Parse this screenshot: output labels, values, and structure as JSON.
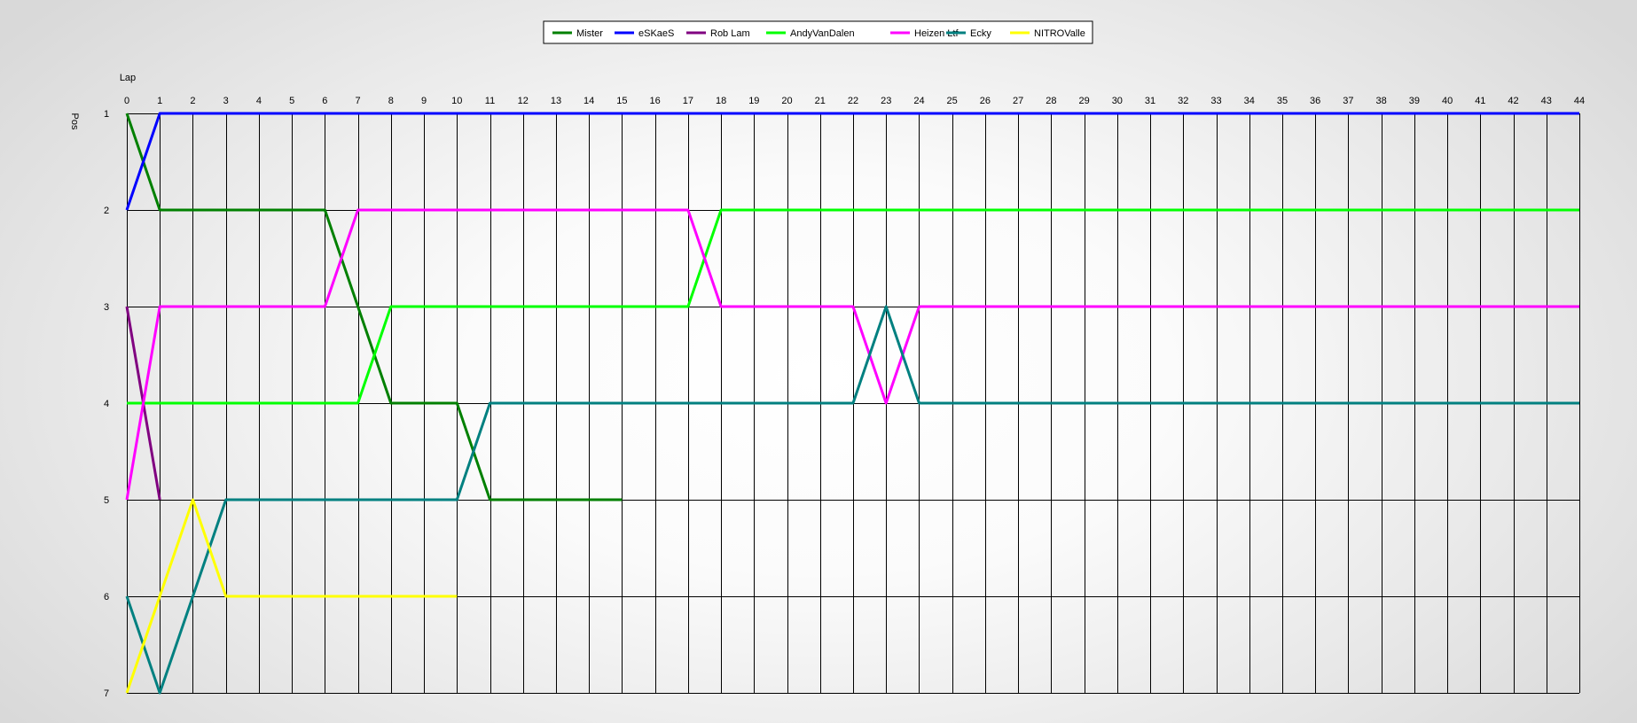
{
  "chart_data": {
    "type": "line",
    "xlabel": "Lap",
    "ylabel": "Pos",
    "xlim": [
      0,
      44
    ],
    "ylim": [
      1,
      7
    ],
    "y_inverted": true,
    "grid": true,
    "legend_position": "top-center",
    "x_ticks": [
      "0",
      "1",
      "2",
      "3",
      "4",
      "5",
      "6",
      "7",
      "8",
      "9",
      "10",
      "11",
      "12",
      "13",
      "14",
      "15",
      "16",
      "17",
      "18",
      "19",
      "20",
      "21",
      "22",
      "23",
      "24",
      "25",
      "26",
      "27",
      "28",
      "29",
      "30",
      "31",
      "32",
      "33",
      "34",
      "35",
      "36",
      "37",
      "38",
      "39",
      "40",
      "41",
      "42",
      "43",
      "44"
    ],
    "y_ticks": [
      "1",
      "2",
      "3",
      "4",
      "5",
      "6",
      "7"
    ],
    "series": [
      {
        "name": "Mister",
        "color": "#008000",
        "x": [
          0,
          1,
          2,
          3,
          4,
          5,
          6,
          7,
          8,
          9,
          10,
          11,
          12,
          13,
          14,
          15
        ],
        "values": [
          1,
          2,
          2,
          2,
          2,
          2,
          2,
          3,
          4,
          4,
          4,
          5,
          5,
          5,
          5,
          5
        ]
      },
      {
        "name": "eSKaeS",
        "color": "#0000ff",
        "x": [
          0,
          1,
          2,
          3,
          4,
          5,
          6,
          7,
          8,
          9,
          10,
          11,
          12,
          13,
          14,
          15,
          16,
          17,
          18,
          19,
          20,
          21,
          22,
          23,
          24,
          25,
          26,
          27,
          28,
          29,
          30,
          31,
          32,
          33,
          34,
          35,
          36,
          37,
          38,
          39,
          40,
          41,
          42,
          43,
          44
        ],
        "values": [
          2,
          1,
          1,
          1,
          1,
          1,
          1,
          1,
          1,
          1,
          1,
          1,
          1,
          1,
          1,
          1,
          1,
          1,
          1,
          1,
          1,
          1,
          1,
          1,
          1,
          1,
          1,
          1,
          1,
          1,
          1,
          1,
          1,
          1,
          1,
          1,
          1,
          1,
          1,
          1,
          1,
          1,
          1,
          1,
          1
        ]
      },
      {
        "name": "Rob Lam",
        "color": "#800080",
        "x": [
          0,
          1
        ],
        "values": [
          3,
          5
        ]
      },
      {
        "name": "AndyVanDalen",
        "color": "#00ff00",
        "x": [
          0,
          1,
          2,
          3,
          4,
          5,
          6,
          7,
          8,
          9,
          10,
          11,
          12,
          13,
          14,
          15,
          16,
          17,
          18,
          19,
          20,
          21,
          22,
          23,
          24,
          25,
          26,
          27,
          28,
          29,
          30,
          31,
          32,
          33,
          34,
          35,
          36,
          37,
          38,
          39,
          40,
          41,
          42,
          43,
          44
        ],
        "values": [
          4,
          4,
          4,
          4,
          4,
          4,
          4,
          4,
          3,
          3,
          3,
          3,
          3,
          3,
          3,
          3,
          3,
          3,
          2,
          2,
          2,
          2,
          2,
          2,
          2,
          2,
          2,
          2,
          2,
          2,
          2,
          2,
          2,
          2,
          2,
          2,
          2,
          2,
          2,
          2,
          2,
          2,
          2,
          2,
          2
        ]
      },
      {
        "name": "Heizen Ltf",
        "color": "#ff00ff",
        "x": [
          0,
          1,
          2,
          3,
          4,
          5,
          6,
          7,
          8,
          9,
          10,
          11,
          12,
          13,
          14,
          15,
          16,
          17,
          18,
          19,
          20,
          21,
          22,
          23,
          24,
          25,
          26,
          27,
          28,
          29,
          30,
          31,
          32,
          33,
          34,
          35,
          36,
          37,
          38,
          39,
          40,
          41,
          42,
          43,
          44
        ],
        "values": [
          5,
          3,
          3,
          3,
          3,
          3,
          3,
          2,
          2,
          2,
          2,
          2,
          2,
          2,
          2,
          2,
          2,
          2,
          3,
          3,
          3,
          3,
          3,
          4,
          3,
          3,
          3,
          3,
          3,
          3,
          3,
          3,
          3,
          3,
          3,
          3,
          3,
          3,
          3,
          3,
          3,
          3,
          3,
          3,
          3
        ]
      },
      {
        "name": "Ecky",
        "color": "#008080",
        "x": [
          0,
          1,
          2,
          3,
          4,
          5,
          6,
          7,
          8,
          9,
          10,
          11,
          12,
          13,
          14,
          15,
          16,
          17,
          18,
          19,
          20,
          21,
          22,
          23,
          24,
          25,
          26,
          27,
          28,
          29,
          30,
          31,
          32,
          33,
          34,
          35,
          36,
          37,
          38,
          39,
          40,
          41,
          42,
          43,
          44
        ],
        "values": [
          6,
          7,
          6,
          5,
          5,
          5,
          5,
          5,
          5,
          5,
          5,
          4,
          4,
          4,
          4,
          4,
          4,
          4,
          4,
          4,
          4,
          4,
          4,
          3,
          4,
          4,
          4,
          4,
          4,
          4,
          4,
          4,
          4,
          4,
          4,
          4,
          4,
          4,
          4,
          4,
          4,
          4,
          4,
          4,
          4
        ]
      },
      {
        "name": "NITROValle",
        "color": "#ffff00",
        "x": [
          0,
          1,
          2,
          3,
          4,
          5,
          6,
          7,
          8,
          9,
          10
        ],
        "values": [
          7,
          6,
          5,
          6,
          6,
          6,
          6,
          6,
          6,
          6,
          6
        ]
      }
    ]
  }
}
